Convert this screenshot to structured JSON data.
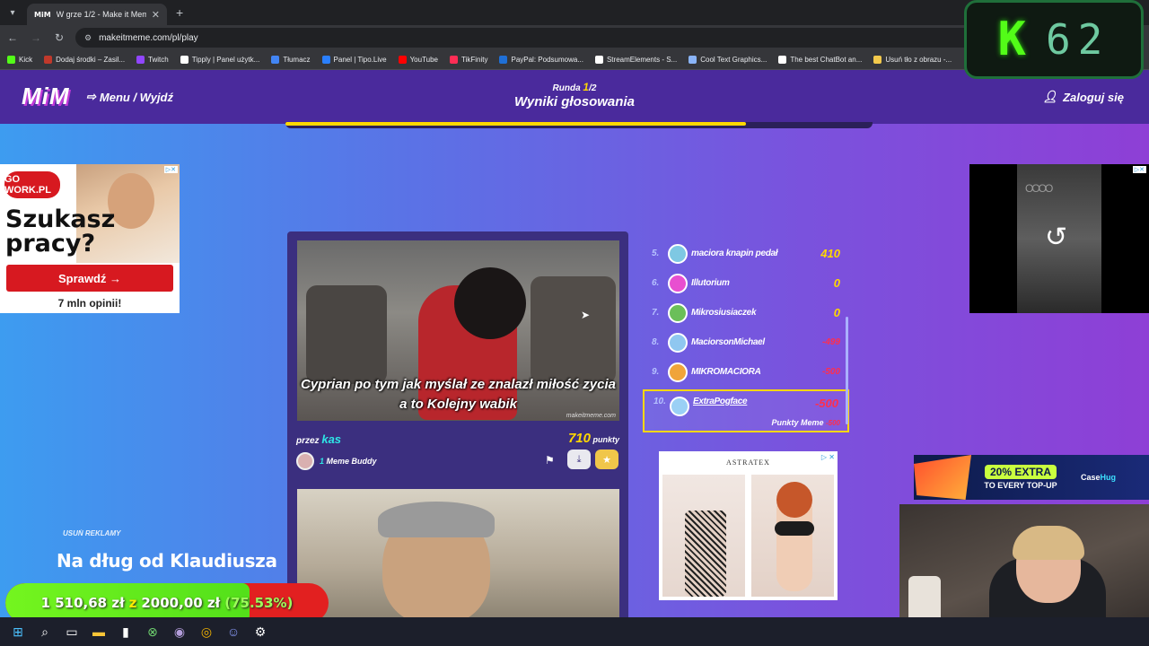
{
  "browser": {
    "tab_title": "W grze 1/2 - Make it Meme",
    "tab_favicon": "MiM",
    "url": "makeitmeme.com/pl/play",
    "bookmarks": [
      {
        "label": "Kick",
        "color": "#53fc18"
      },
      {
        "label": "Dodaj środki – Zasil...",
        "color": "#c0392b"
      },
      {
        "label": "Twitch",
        "color": "#9146ff"
      },
      {
        "label": "Tipply | Panel użytk...",
        "color": "#ffffff"
      },
      {
        "label": "Tłumacz",
        "color": "#4285f4"
      },
      {
        "label": "Panel | Tipo.Live",
        "color": "#2a7fff"
      },
      {
        "label": "YouTube",
        "color": "#ff0000"
      },
      {
        "label": "TikFinity",
        "color": "#ff2d55"
      },
      {
        "label": "PayPal: Podsumowa...",
        "color": "#1f6fd6"
      },
      {
        "label": "StreamElements - S...",
        "color": "#ffffff"
      },
      {
        "label": "Cool Text Graphics...",
        "color": "#8ab4f8"
      },
      {
        "label": "The best ChatBot an...",
        "color": "#ffffff"
      },
      {
        "label": "Usuń tło z obrazu -...",
        "color": "#f2c94c"
      }
    ]
  },
  "header": {
    "logo": "MiM",
    "menu": "Menu / Wyjdź",
    "round_prefix": "Runda",
    "round_current": "1",
    "round_total": "/2",
    "title": "Wyniki głosowania",
    "login": "Zaloguj się",
    "progress": 0.785
  },
  "ad_left": {
    "logo": "GO WORK.PL",
    "headline_1": "Szukasz",
    "headline_2": "pracy?",
    "cta": "Sprawdź →",
    "sub": "7 mln opinii!"
  },
  "ad_right": {
    "logo": "OOOO"
  },
  "meme": {
    "caption": "Cyprian po tym jak myślał ze znalazł miłość zycia a to Kolejny wabik",
    "watermark": "makeitmeme.com",
    "by_label": "przez",
    "author": "kas",
    "points": "710",
    "points_label": "punkty",
    "buddy_count": "1",
    "buddy_label": "Meme Buddy"
  },
  "leaderboard": [
    {
      "rank": "5.",
      "name": "maciora knapin pedał",
      "score": "410",
      "negative": false,
      "avatar": "#7ec8e3"
    },
    {
      "rank": "6.",
      "name": "Illutorium",
      "score": "0",
      "negative": false,
      "avatar": "#e84fd0"
    },
    {
      "rank": "7.",
      "name": "Mikrosiusiaczek",
      "score": "0",
      "negative": false,
      "avatar": "#6bbf59"
    },
    {
      "rank": "8.",
      "name": "MaciorsonMichael",
      "score": "-499",
      "negative": true,
      "avatar": "#8fc7f0"
    },
    {
      "rank": "9.",
      "name": "MIKROMACIORA",
      "score": "-500",
      "negative": true,
      "avatar": "#f0a43a"
    },
    {
      "rank": "10.",
      "name": "ExtraPogface",
      "score": "-500",
      "negative": true,
      "avatar": "#9ad0f5",
      "sub_label": "Punkty Meme",
      "sub_value": "-500"
    }
  ],
  "ad_bottom": {
    "title": "ASTRATEX"
  },
  "remove_ads": "USUŃ REKLAMY",
  "overlay": {
    "kick_letter": "K",
    "kick_count": "62",
    "goal_title": "Na dług od Klaudiusza",
    "goal_current": "1 510,68 zł",
    "goal_sep": "z",
    "goal_target": "2000,00 zł",
    "goal_pct": "(75.53%)",
    "goal_fraction": 0.7553,
    "promo_pill": "20% EXTRA",
    "promo_sub": "TO EVERY TOP-UP",
    "promo_brand_a": "Case",
    "promo_brand_b": "Hug"
  },
  "colors": {
    "accent_yellow": "#ffd700",
    "accent_cyan": "#2ee6e6",
    "negative_red": "#ff2e4e",
    "header_bg": "#4a2a9c"
  }
}
